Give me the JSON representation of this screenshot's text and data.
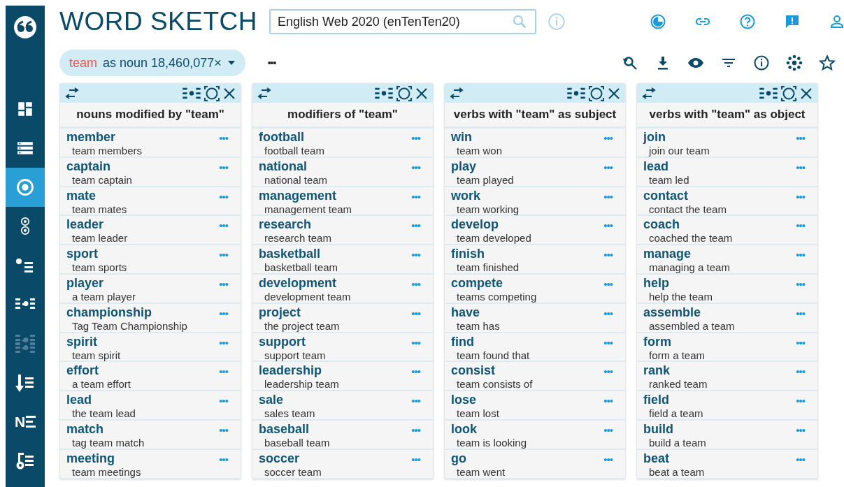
{
  "sidebar": {
    "items": [
      {
        "kind": "dashboard",
        "selected": false,
        "disabled": false
      },
      {
        "kind": "list",
        "selected": false,
        "disabled": false
      },
      {
        "kind": "target",
        "selected": true,
        "disabled": false
      },
      {
        "kind": "double-target",
        "selected": false,
        "disabled": false
      },
      {
        "kind": "dot-list",
        "selected": false,
        "disabled": false
      },
      {
        "kind": "dots-list",
        "selected": false,
        "disabled": false
      },
      {
        "kind": "dots-grid",
        "selected": false,
        "disabled": true
      },
      {
        "kind": "sort-list",
        "selected": false,
        "disabled": false
      },
      {
        "kind": "letter-list",
        "label": "N",
        "selected": false,
        "disabled": false
      },
      {
        "kind": "note-list",
        "selected": false,
        "disabled": false
      }
    ]
  },
  "header": {
    "title": "WORD SKETCH",
    "corpus_field": {
      "value": "English Web 2020 (enTenTen20)"
    }
  },
  "query": {
    "word": "team",
    "details": "as noun 18,460,077×",
    "more": "•••"
  },
  "columns": [
    {
      "title": "nouns modified by \"team\"",
      "items": [
        {
          "word": "member",
          "example": "team members"
        },
        {
          "word": "captain",
          "example": "team captain"
        },
        {
          "word": "mate",
          "example": "team mates"
        },
        {
          "word": "leader",
          "example": "team leader"
        },
        {
          "word": "sport",
          "example": "team sports"
        },
        {
          "word": "player",
          "example": "a team player"
        },
        {
          "word": "championship",
          "example": "Tag Team Championship"
        },
        {
          "word": "spirit",
          "example": "team spirit"
        },
        {
          "word": "effort",
          "example": "a team effort"
        },
        {
          "word": "lead",
          "example": "the team lead"
        },
        {
          "word": "match",
          "example": "tag team match"
        },
        {
          "word": "meeting",
          "example": "team meetings"
        }
      ]
    },
    {
      "title": "modifiers of \"team\"",
      "items": [
        {
          "word": "football",
          "example": "football team"
        },
        {
          "word": "national",
          "example": "national team"
        },
        {
          "word": "management",
          "example": "management team"
        },
        {
          "word": "research",
          "example": "research team"
        },
        {
          "word": "basketball",
          "example": "basketball team"
        },
        {
          "word": "development",
          "example": "development team"
        },
        {
          "word": "project",
          "example": "the project team"
        },
        {
          "word": "support",
          "example": "support team"
        },
        {
          "word": "leadership",
          "example": "leadership team"
        },
        {
          "word": "sale",
          "example": "sales team"
        },
        {
          "word": "baseball",
          "example": "baseball team"
        },
        {
          "word": "soccer",
          "example": "soccer team"
        }
      ]
    },
    {
      "title": "verbs with \"team\" as subject",
      "items": [
        {
          "word": "win",
          "example": "team won"
        },
        {
          "word": "play",
          "example": "team played"
        },
        {
          "word": "work",
          "example": "team working"
        },
        {
          "word": "develop",
          "example": "team developed"
        },
        {
          "word": "finish",
          "example": "team finished"
        },
        {
          "word": "compete",
          "example": "teams competing"
        },
        {
          "word": "have",
          "example": "team has"
        },
        {
          "word": "find",
          "example": "team found that"
        },
        {
          "word": "consist",
          "example": "team consists of"
        },
        {
          "word": "lose",
          "example": "team lost"
        },
        {
          "word": "look",
          "example": "team is looking"
        },
        {
          "word": "go",
          "example": "team went"
        }
      ]
    },
    {
      "title": "verbs with \"team\" as object",
      "items": [
        {
          "word": "join",
          "example": "join our team"
        },
        {
          "word": "lead",
          "example": "team led"
        },
        {
          "word": "contact",
          "example": "contact the team"
        },
        {
          "word": "coach",
          "example": "coached the team"
        },
        {
          "word": "manage",
          "example": "managing a team"
        },
        {
          "word": "help",
          "example": "help the team"
        },
        {
          "word": "assemble",
          "example": "assembled a team"
        },
        {
          "word": "form",
          "example": "form a team"
        },
        {
          "word": "rank",
          "example": "ranked team"
        },
        {
          "word": "field",
          "example": "field a team"
        },
        {
          "word": "build",
          "example": "build a team"
        },
        {
          "word": "beat",
          "example": "beat a team"
        }
      ]
    }
  ],
  "row_menu": "•••"
}
